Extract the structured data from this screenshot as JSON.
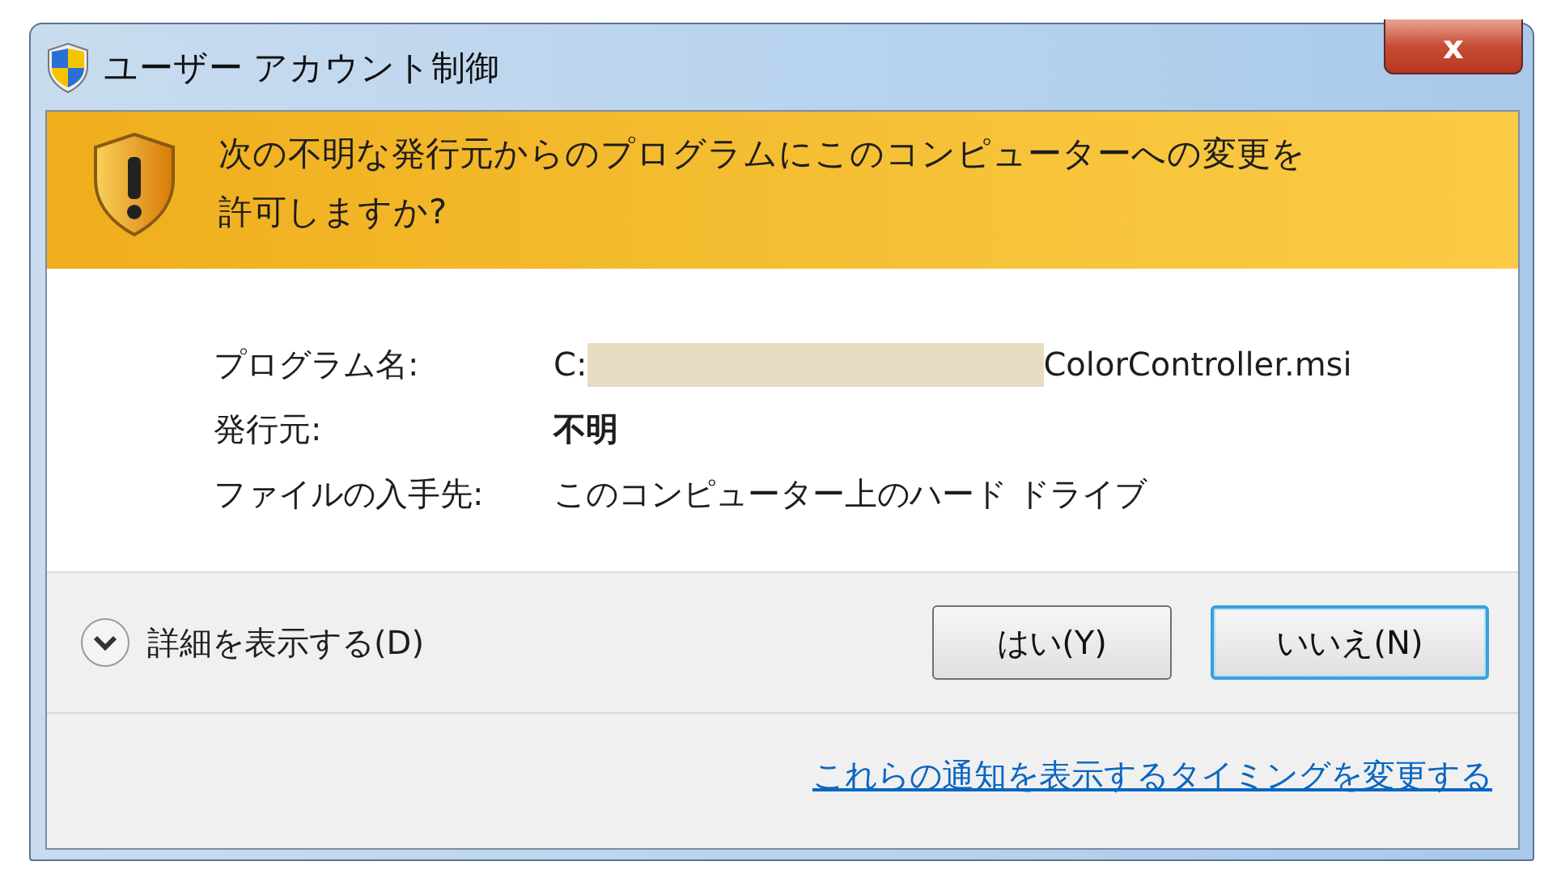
{
  "window": {
    "title": "ユーザー アカウント制御",
    "close": "x"
  },
  "banner": {
    "message": "次の不明な発行元からのプログラムにこのコンピューターへの変更を許可しますか?"
  },
  "details": [
    {
      "label": "プログラム名:",
      "kind": "path",
      "prefix": "C:",
      "suffix": "ColorController.msi",
      "redacted": true
    },
    {
      "label": "発行元:",
      "kind": "bold",
      "value": "不明"
    },
    {
      "label": "ファイルの入手先:",
      "kind": "plain",
      "value": "このコンピューター上のハード ドライブ"
    }
  ],
  "show_details": {
    "label": "詳細を表示する(D)",
    "expanded": false
  },
  "buttons": [
    {
      "label": "はい(Y)",
      "default": false
    },
    {
      "label": "いいえ(N)",
      "default": true
    }
  ],
  "link": "これらの通知を表示するタイミングを変更する"
}
